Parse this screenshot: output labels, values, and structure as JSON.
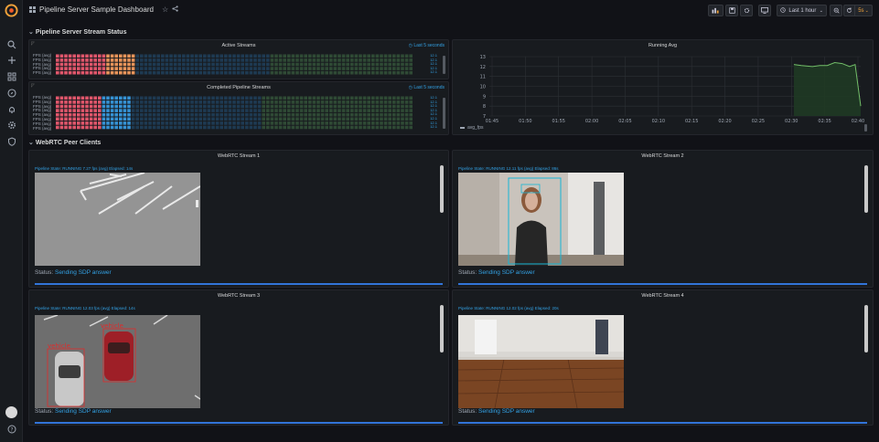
{
  "dashboard": {
    "title": "Pipeline Server Sample Dashboard"
  },
  "toolbar": {
    "time_range": "Last 1 hour",
    "refresh": "5s"
  },
  "rows": [
    {
      "title": "Pipeline Server Stream Status"
    },
    {
      "title": "WebRTC Peer Clients"
    }
  ],
  "active_streams": {
    "title": "Active Streams",
    "link": "Last 5 seconds",
    "fps_labels": [
      "FPS (avg)",
      "FPS (avg)",
      "FPS (avg)",
      "FPS (avg)",
      "FPS (avg)"
    ],
    "values": [
      "12.1",
      "12.1",
      "12.1",
      "12.1",
      "12.1"
    ]
  },
  "completed_streams": {
    "title": "Completed Pipeline Streams",
    "link": "Last 5 seconds",
    "fps_labels": [
      "FPS (avg)",
      "FPS (avg)",
      "FPS (avg)",
      "FPS (avg)",
      "FPS (avg)",
      "FPS (avg)",
      "FPS (avg)",
      "FPS (avg)"
    ],
    "values": [
      "12.1",
      "12.1",
      "12.1",
      "12.1",
      "12.1",
      "12.1",
      "12.1",
      "12.1"
    ]
  },
  "running_avg": {
    "title": "Running Avg",
    "legend": "avg_fps"
  },
  "chart_data": {
    "type": "line",
    "title": "Running Avg",
    "x": [
      "01:45",
      "01:50",
      "01:55",
      "02:00",
      "02:05",
      "02:10",
      "02:15",
      "02:20",
      "02:25",
      "02:30",
      "02:35",
      "02:40"
    ],
    "yticks": [
      7,
      8,
      9,
      10,
      11,
      12,
      13
    ],
    "ylim": [
      7,
      13
    ],
    "series": [
      {
        "name": "avg_fps",
        "points": [
          [
            0.82,
            12.2
          ],
          [
            0.84,
            12.1
          ],
          [
            0.87,
            12.0
          ],
          [
            0.89,
            12.1
          ],
          [
            0.91,
            12.1
          ],
          [
            0.93,
            12.4
          ],
          [
            0.95,
            12.3
          ],
          [
            0.97,
            12.0
          ],
          [
            0.985,
            12.2
          ],
          [
            1.0,
            8.0
          ]
        ]
      }
    ],
    "legend_position": "bottom-left",
    "grid": true
  },
  "webrtc": [
    {
      "title": "WebRTC Stream 1",
      "state": "Pipeline State: RUNNING 7.27 fps (avg) Elapsed: 14s",
      "status_label": "Status:",
      "status_value": "Sending SDP answer"
    },
    {
      "title": "WebRTC Stream 2",
      "state": "Pipeline State: RUNNING 12.11 fps (avg) Elapsed: 86s",
      "status_label": "Status:",
      "status_value": "Sending SDP answer"
    },
    {
      "title": "WebRTC Stream 3",
      "state": "Pipeline State: RUNNING 12.03 fps (avg) Elapsed: 14s",
      "status_label": "Status:",
      "status_value": "Sending SDP answer",
      "detections": [
        "vehicle",
        "vehicle"
      ]
    },
    {
      "title": "WebRTC Stream 4",
      "state": "Pipeline State: RUNNING 12.02 fps (avg) Elapsed: 20s",
      "status_label": "Status:",
      "status_value": "Sending SDP answer"
    }
  ],
  "colors": {
    "red": "#e0566b",
    "orange": "#e8945a",
    "blue": "#3592d4",
    "dark_blue": "#1e3a52",
    "green": "#2f4a35",
    "accent": "#33a2e5"
  }
}
